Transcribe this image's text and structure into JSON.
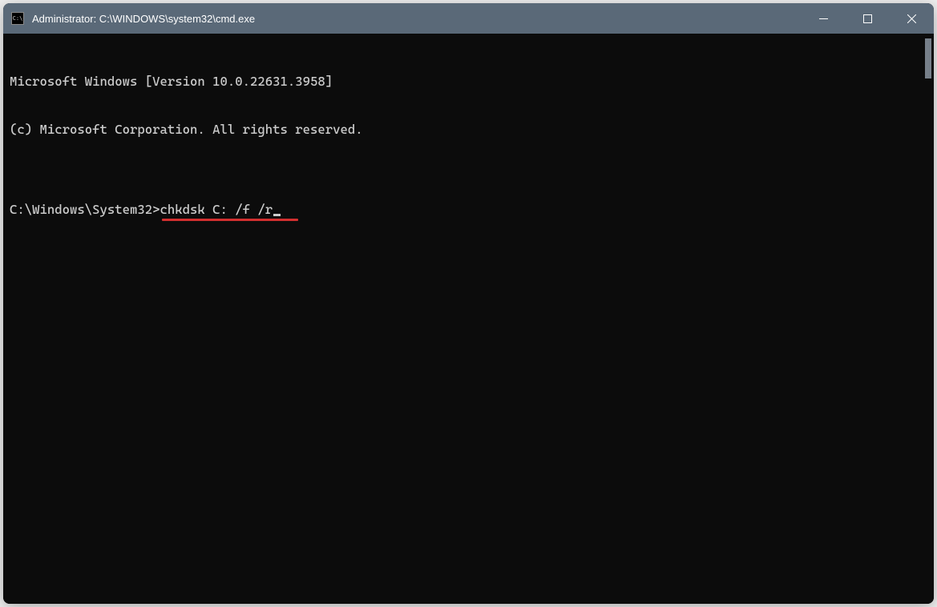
{
  "titlebar": {
    "icon_label": "C:\\",
    "title": "Administrator: C:\\WINDOWS\\system32\\cmd.exe"
  },
  "terminal": {
    "line1": "Microsoft Windows [Version 10.0.22631.3958]",
    "line2": "(c) Microsoft Corporation. All rights reserved.",
    "blank": "",
    "prompt": "C:\\Windows\\System32>",
    "command": "chkdsk C: /f /r"
  }
}
